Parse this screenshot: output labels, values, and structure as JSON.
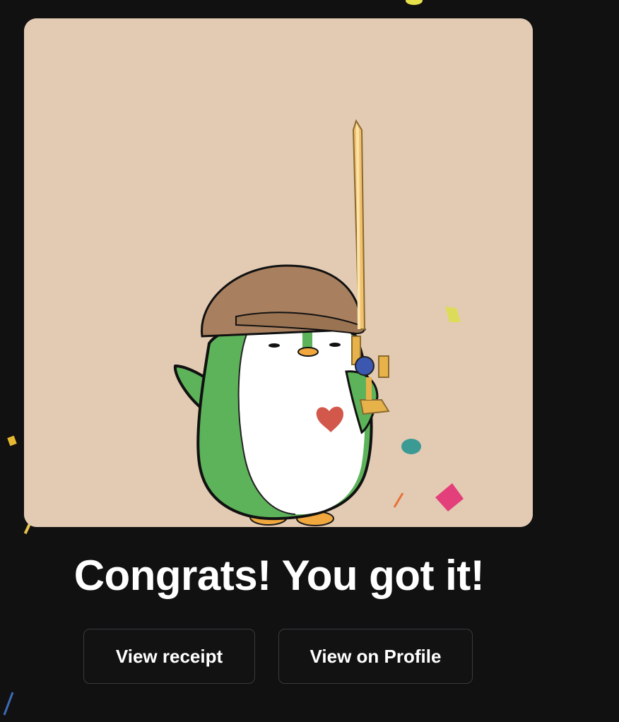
{
  "nft_card": {
    "image_description_icon": "penguin-with-sword-icon",
    "background_color": "#e3cbb3"
  },
  "result": {
    "headline": "Congrats! You got it!"
  },
  "actions": {
    "view_receipt_label": "View receipt",
    "view_on_profile_label": "View on Profile"
  },
  "colors": {
    "page_background": "#111112",
    "button_border": "#3a3a3d",
    "text": "#ffffff"
  }
}
